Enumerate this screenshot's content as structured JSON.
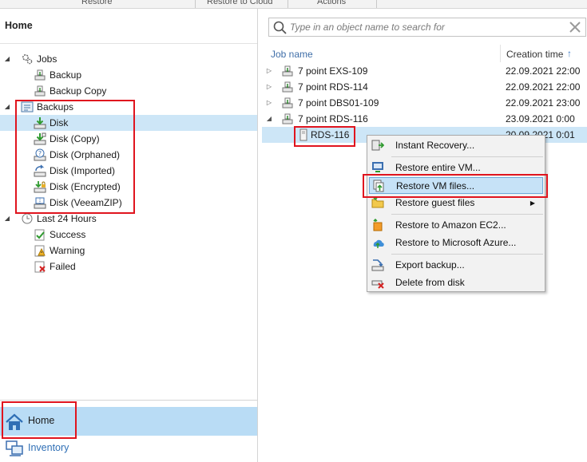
{
  "ribbon": {
    "groups": [
      "Restore",
      "Restore to Cloud",
      "Actions"
    ]
  },
  "left_panel": {
    "title": "Home",
    "tree": [
      {
        "label": "Jobs",
        "icon": "gear-icon",
        "expanded": true
      },
      {
        "label": "Backup",
        "icon": "job-icon"
      },
      {
        "label": "Backup Copy",
        "icon": "job-icon"
      },
      {
        "label": "Backups",
        "icon": "backups-icon",
        "expanded": true
      },
      {
        "label": "Disk",
        "icon": "disk-icon",
        "selected": true
      },
      {
        "label": "Disk (Copy)",
        "icon": "disk-copy-icon"
      },
      {
        "label": "Disk (Orphaned)",
        "icon": "disk-orphaned-icon"
      },
      {
        "label": "Disk (Imported)",
        "icon": "disk-imported-icon"
      },
      {
        "label": "Disk (Encrypted)",
        "icon": "disk-encrypted-icon"
      },
      {
        "label": "Disk (VeeamZIP)",
        "icon": "disk-veeamzip-icon"
      },
      {
        "label": "Last 24 Hours",
        "icon": "clock-icon",
        "expanded": true
      },
      {
        "label": "Success",
        "icon": "success-icon"
      },
      {
        "label": "Warning",
        "icon": "warning-icon"
      },
      {
        "label": "Failed",
        "icon": "failed-icon"
      }
    ],
    "nav": {
      "home_label": "Home",
      "inventory_label": "Inventory"
    }
  },
  "right_panel": {
    "search": {
      "placeholder": "Type in an object name to search for"
    },
    "columns": {
      "name": "Job name",
      "created": "Creation time"
    },
    "rows": [
      {
        "name": "7 point EXS-109",
        "created": "22.09.2021 22:00"
      },
      {
        "name": "7 point RDS-114",
        "created": "22.09.2021 22:00"
      },
      {
        "name": "7 point DBS01-109",
        "created": "22.09.2021 23:00"
      },
      {
        "name": "7 point RDS-116",
        "created": "23.09.2021 0:00"
      },
      {
        "name": "RDS-116",
        "created": "20.09.2021 0:01"
      }
    ]
  },
  "context_menu": {
    "items": [
      {
        "label": "Instant Recovery...",
        "icon": "instant-recovery-icon"
      },
      {
        "label": "Restore entire VM...",
        "icon": "restore-vm-icon"
      },
      {
        "label": "Restore VM files...",
        "icon": "restore-files-icon",
        "highlighted": true
      },
      {
        "label": "Restore guest files",
        "icon": "guest-files-icon",
        "submenu": true
      },
      {
        "label": "Restore to Amazon EC2...",
        "icon": "amazon-ec2-icon"
      },
      {
        "label": "Restore to Microsoft Azure...",
        "icon": "azure-icon"
      },
      {
        "label": "Export backup...",
        "icon": "export-icon"
      },
      {
        "label": "Delete from disk",
        "icon": "delete-icon"
      }
    ]
  },
  "colors": {
    "selection": "#cde6f7",
    "nav_home": "#b9dcf5",
    "menu_highlight": "#c6e2f7",
    "annotation": "#e0141e",
    "link": "#3f6ea8"
  }
}
